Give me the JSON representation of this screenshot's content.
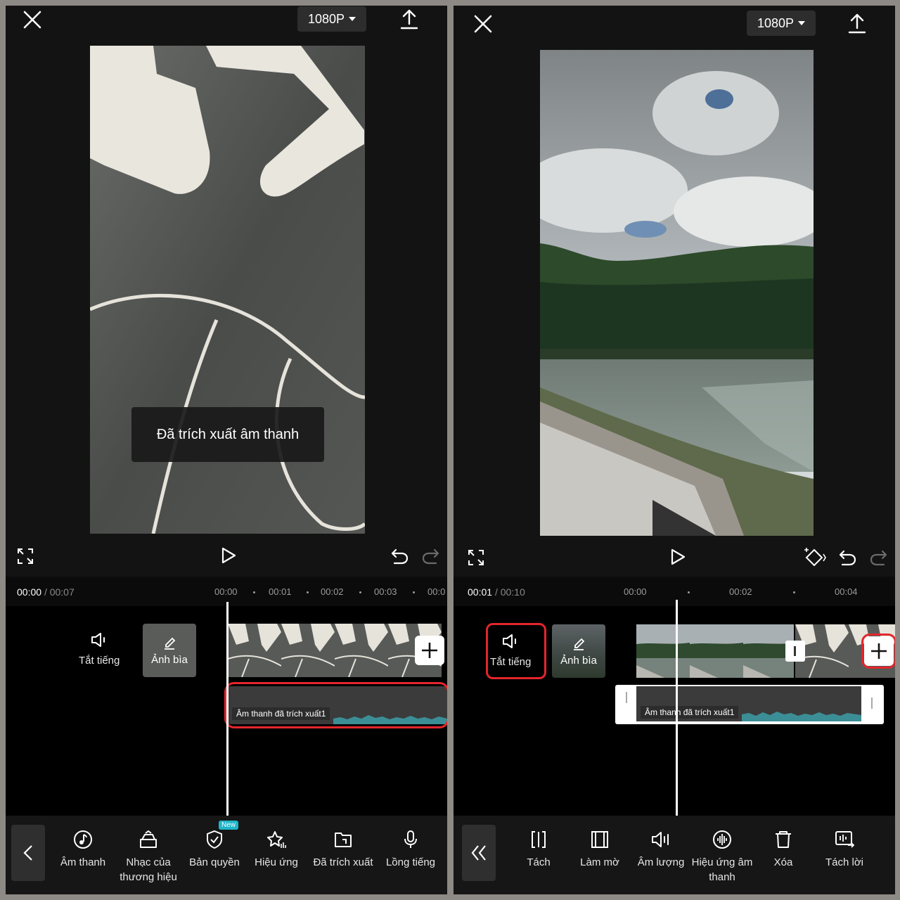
{
  "left": {
    "resolution": "1080P",
    "toast": "Đã trích xuất âm thanh",
    "time_current": "00:00",
    "time_separator": "/",
    "time_total": "00:07",
    "ticks": [
      "00:00",
      "00:01",
      "00:02",
      "00:03",
      "00:0"
    ],
    "mute_label": "Tắt tiếng",
    "cover_label": "Ảnh bìa",
    "audio_clip_label": "Âm thanh đã trích xuất1",
    "toolbar": [
      {
        "label": "Âm thanh",
        "icon": "music-note-icon"
      },
      {
        "label": "Nhạc của thương hiệu",
        "icon": "brand-music-icon"
      },
      {
        "label": "Bản quyền",
        "icon": "copyright-shield-icon",
        "badge": "New"
      },
      {
        "label": "Hiệu ứng",
        "icon": "effect-star-icon"
      },
      {
        "label": "Đã trích xuất",
        "icon": "extracted-folder-icon"
      },
      {
        "label": "Lồng tiếng",
        "icon": "microphone-icon"
      }
    ]
  },
  "right": {
    "resolution": "1080P",
    "time_current": "00:01",
    "time_separator": "/",
    "time_total": "00:10",
    "ticks": [
      "00:00",
      "00:02",
      "00:04"
    ],
    "mute_label": "Tắt tiếng",
    "cover_label": "Ảnh bìa",
    "audio_clip_label": "Âm thanh đã trích xuất1",
    "toolbar": [
      {
        "label": "Tách",
        "icon": "split-icon"
      },
      {
        "label": "Làm mờ",
        "icon": "fade-icon"
      },
      {
        "label": "Âm lượng",
        "icon": "volume-icon"
      },
      {
        "label": "Hiệu ứng âm thanh",
        "icon": "sound-effect-icon"
      },
      {
        "label": "Xóa",
        "icon": "delete-icon"
      },
      {
        "label": "Tách lời",
        "icon": "extract-lyrics-icon"
      }
    ]
  },
  "colors": {
    "highlight": "#e3262c",
    "waveform": "#3c8e96",
    "new_badge": "#1fb5c9"
  }
}
